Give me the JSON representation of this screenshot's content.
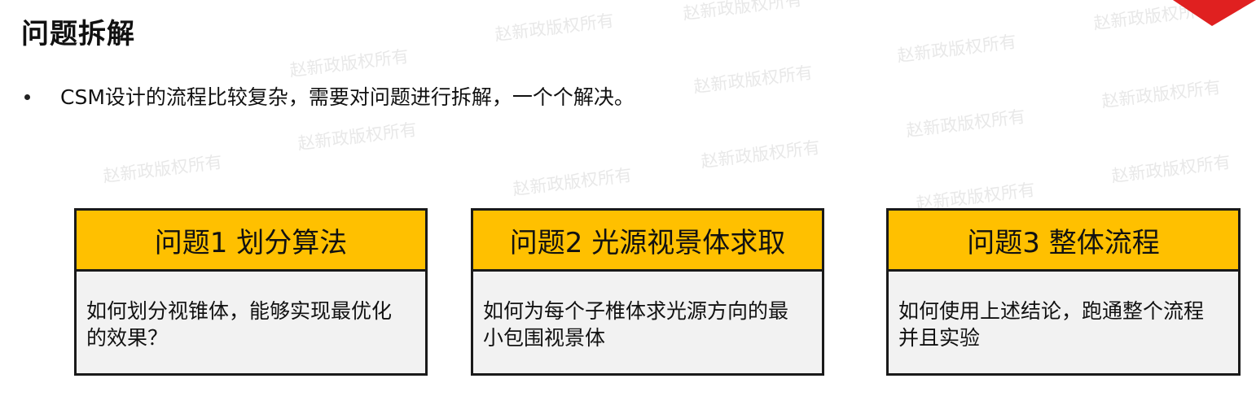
{
  "slide": {
    "title": "问题拆解",
    "bullet": "CSM设计的流程比较复杂，需要对问题进行拆解，一个个解决。",
    "watermark_text": "赵新政版权所有",
    "cards": [
      {
        "heading": "问题1 划分算法",
        "body": "如何划分视锥体，能够实现最优化的效果？"
      },
      {
        "heading": "问题2 光源视景体求取",
        "body": "如何为每个子椎体求光源方向的最小包围视景体"
      },
      {
        "heading": "问题3 整体流程",
        "body": "如何使用上述结论，跑通整个流程并且实验"
      }
    ]
  },
  "colors": {
    "card_header": "#ffc000",
    "card_body": "#f2f2f2",
    "corner_accent": "#e02020"
  }
}
